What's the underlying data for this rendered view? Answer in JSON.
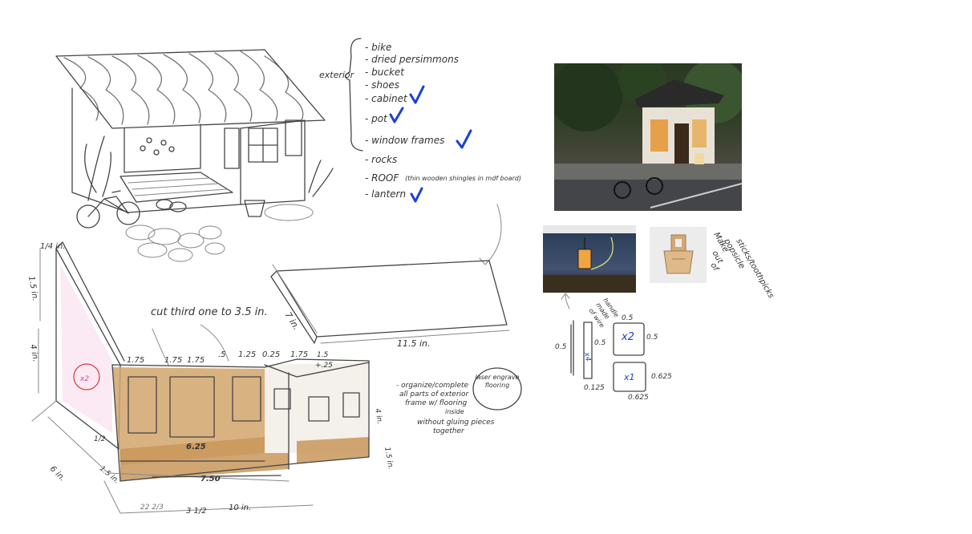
{
  "checklist": {
    "group_label": "exterior",
    "items": [
      {
        "text": "- bike",
        "checked": false
      },
      {
        "text": "- dried persimmons",
        "checked": false
      },
      {
        "text": "- bucket",
        "checked": false
      },
      {
        "text": "- shoes",
        "checked": false
      },
      {
        "text": "- cabinet",
        "checked": true
      },
      {
        "text": "- pot",
        "checked": true
      },
      {
        "text": "- window frames",
        "checked": true
      },
      {
        "text": "- rocks",
        "checked": false
      },
      {
        "text": "- ROOF",
        "checked": false
      },
      {
        "text": "- lantern",
        "checked": true
      }
    ],
    "roof_note": "(thin wooden shingles in mdf board)"
  },
  "roof_sketch": {
    "depth_label": "7 in.",
    "width_label": "11.5 in."
  },
  "frame_sketch": {
    "top_label": "1/4 in.",
    "height_label_top": "1.5 in.",
    "height_label_left": "4 in.",
    "cut_note": "cut third one to 3.5 in.",
    "top_measures": [
      "1.75",
      "1.75",
      "1.75",
      ".5",
      "1.25",
      "0.25",
      "1.75",
      "1.5"
    ],
    "red_measure": "+.25",
    "inner_measure": "6.25",
    "base_measure": "7.50",
    "depth_label": "6 in.",
    "side_label": "1.5 in.",
    "left_small": "1/2",
    "bottom_label": "10 in.",
    "red_bottom": "3 1/2",
    "pink_bottom": "22   2/3",
    "right_labels": [
      "4 in.",
      "1.5 in."
    ],
    "circle_label": "x2"
  },
  "frame_notes": {
    "line1": "- organize/complete",
    "line2": "all parts of exterior",
    "line3": "frame w/ flooring",
    "line4": "inside",
    "line5": "without gluing pieces",
    "line6": "together",
    "bubble": "laser engrave flooring"
  },
  "bucket_notes": {
    "side_note_lines": [
      "Make",
      "out",
      "of",
      "popsicle",
      "sticks/toothpicks"
    ],
    "handle_note_lines": [
      "handle",
      "made",
      "of wire"
    ],
    "dims": {
      "stick_w": "0.5",
      "stick_h": "0.5",
      "stick_mult": "x4",
      "stick_bottom": "0.125",
      "sq1_top": "0.5",
      "sq1_right": "0.5",
      "sq1_mult": "x2",
      "sq2_right": "0.625",
      "sq2_bottom": "0.625",
      "sq2_mult": "x1"
    }
  },
  "colors": {
    "check_blue": "#1a3fd6",
    "pencil": "#444444",
    "wood": "#d2a46b",
    "red": "#d63a3a",
    "pink": "#d83fb3"
  }
}
